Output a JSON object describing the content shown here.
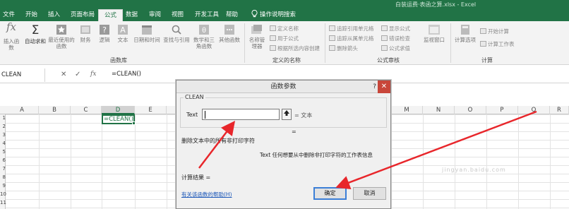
{
  "window": {
    "title": "白装运费·表函之算.xlsx - Excel"
  },
  "tabs": [
    {
      "id": "file",
      "label": "文件"
    },
    {
      "id": "home",
      "label": "开始"
    },
    {
      "id": "insert",
      "label": "插入"
    },
    {
      "id": "layout",
      "label": "页面布局"
    },
    {
      "id": "formulas",
      "label": "公式",
      "active": true
    },
    {
      "id": "data",
      "label": "数据"
    },
    {
      "id": "review",
      "label": "审阅"
    },
    {
      "id": "view",
      "label": "视图"
    },
    {
      "id": "developer",
      "label": "开发工具"
    },
    {
      "id": "help",
      "label": "帮助"
    },
    {
      "id": "tellme",
      "label": "操作说明搜索"
    }
  ],
  "ribbon": {
    "insert_function": {
      "icon": "fx-icon",
      "label": "插入函数"
    },
    "autosum": {
      "icon": "sigma-icon",
      "label": "自动求和"
    },
    "recent": {
      "icon": "star-icon",
      "label": "最近使用的函数"
    },
    "financial": {
      "icon": "financial-icon",
      "label": "财务"
    },
    "logical": {
      "icon": "question-icon",
      "label": "逻辑"
    },
    "text": {
      "icon": "text-icon",
      "label": "文本"
    },
    "datetime": {
      "icon": "calendar-icon",
      "label": "日期和时间"
    },
    "lookup": {
      "icon": "search-icon",
      "label": "查找与引用"
    },
    "math": {
      "icon": "math-icon",
      "label": "数学和三角函数"
    },
    "more": {
      "icon": "more-functions-icon",
      "label": "其他函数"
    },
    "library_label": "函数库",
    "name_manager": {
      "icon": "name-manager-icon",
      "label": "名称管理器"
    },
    "define_name": "定义名称",
    "use_in_formula": "用于公式",
    "create_from_selection": "根据所选内容创建",
    "defined_names_label": "定义的名称",
    "trace_precedents": "追踪引用单元格",
    "trace_dependents": "追踪从属单元格",
    "remove_arrows": "删除箭头",
    "show_formulas": "显示公式",
    "error_checking": "错误检查",
    "evaluate_formula": "公式求值",
    "watch_window": {
      "icon": "watch-window-icon",
      "label": "监视窗口"
    },
    "auditing_label": "公式审核",
    "calc_options": {
      "icon": "calc-options-icon",
      "label": "计算选项"
    },
    "calc_now": "开始计算",
    "calc_sheet": "计算工作表",
    "calculation_label": "计算"
  },
  "formula_bar": {
    "name_box": "CLEAN",
    "cancel": "✕",
    "enter": "✓",
    "fx": "fx",
    "content": "=CLEAN()"
  },
  "grid": {
    "columns": [
      "A",
      "B",
      "C",
      "D",
      "E",
      "M",
      "N",
      "O",
      "P",
      "Q",
      "R"
    ],
    "selected_column": "D",
    "rows": [
      "1",
      "2",
      "3",
      "4",
      "5",
      "6",
      "7",
      "8",
      "9",
      "10",
      "11"
    ],
    "active_cell_value": "=CLEAN()"
  },
  "dialog": {
    "title": "函数参数",
    "help_btn": "?",
    "close_btn": "✕",
    "function_name": "CLEAN",
    "arg_label": "Text",
    "arg_value": "= 文本",
    "result_eq": "=",
    "description": "删除文本中的所有非打印字符",
    "param_desc": "Text  任何想要从中删除非打印字符的工作表信息",
    "calc_result": "计算结果 =",
    "help_link": "有关该函数的帮助(H)",
    "ok": "确定",
    "cancel": "取消"
  },
  "annotations": {
    "color": "#e8262b"
  },
  "watermark": "jingyan.baidu.com"
}
